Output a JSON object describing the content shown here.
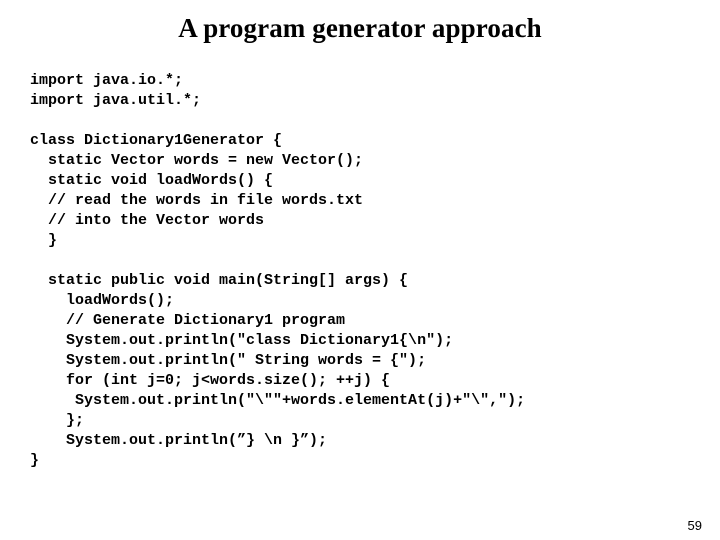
{
  "slide": {
    "title": "A program generator approach",
    "page_number": "59",
    "background_color": "#ffffff",
    "text_color": "#000000",
    "code_lines": [
      "import java.io.*;",
      "import java.util.*;",
      "",
      "class Dictionary1Generator {",
      "  static Vector words = new Vector();",
      "  static void loadWords() {",
      "  // read the words in file words.txt",
      "  // into the Vector words",
      "  }",
      "",
      "  static public void main(String[] args) {",
      "    loadWords();",
      "    // Generate Dictionary1 program",
      "    System.out.println(\"class Dictionary1{\\n\");",
      "    System.out.println(\" String words = {\");",
      "    for (int j=0; j<words.size(); ++j) {",
      "     System.out.println(\"\\\"\"+words.elementAt(j)+\"\\\",\");",
      "    };",
      "    System.out.println(”} \\n }”);",
      "}"
    ]
  }
}
